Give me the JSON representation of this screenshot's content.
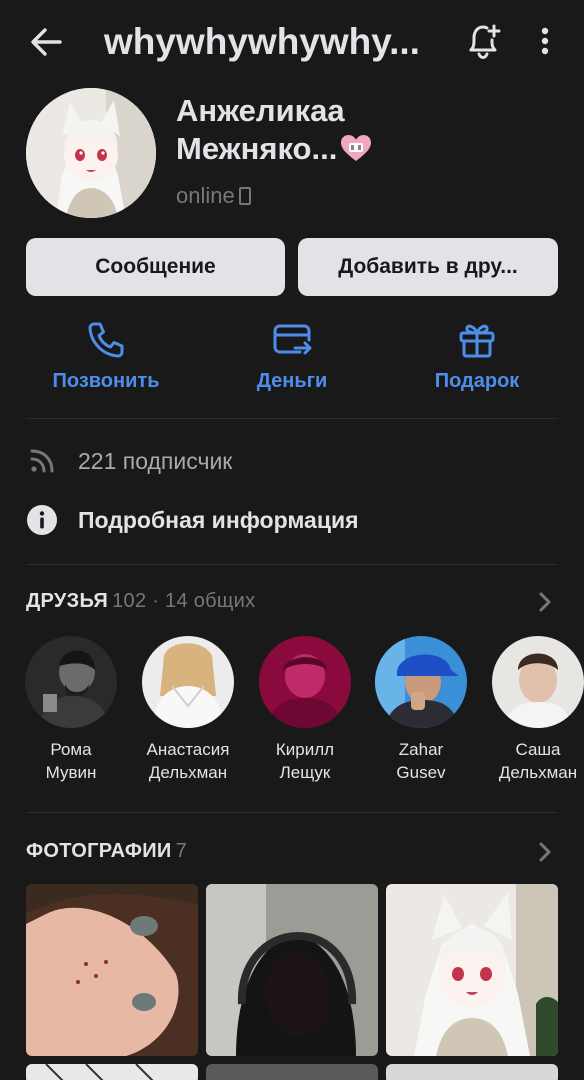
{
  "header": {
    "title": "whywhywhywhy...",
    "back_icon": "arrow-left-icon",
    "bell_icon": "bell-plus-icon",
    "more_icon": "more-vertical-icon"
  },
  "profile": {
    "name_line1": "Анжеликаа",
    "name_line2": "Межняко...",
    "status": "online"
  },
  "buttons": {
    "message": "Сообщение",
    "add_friend": "Добавить в дру..."
  },
  "actions": [
    {
      "label": "Позвонить",
      "icon": "phone-icon"
    },
    {
      "label": "Деньги",
      "icon": "money-transfer-icon"
    },
    {
      "label": "Подарок",
      "icon": "gift-icon"
    }
  ],
  "info": {
    "followers": "221 подписчик",
    "details": "Подробная информация"
  },
  "friends_section": {
    "title": "ДРУЗЬЯ",
    "count": "102 · 14 общих",
    "items": [
      {
        "line1": "Рома",
        "line2": "Мувин"
      },
      {
        "line1": "Анастасия",
        "line2": "Дельхман"
      },
      {
        "line1": "Кирилл",
        "line2": "Лещук"
      },
      {
        "line1": "Zahar",
        "line2": "Gusev"
      },
      {
        "line1": "Саша",
        "line2": "Дельхман"
      }
    ]
  },
  "photos_section": {
    "title": "ФОТОГРАФИИ",
    "count": "7"
  },
  "colors": {
    "background": "#19191a",
    "accent": "#4c8ee9",
    "text": "#e1e3e6",
    "secondary": "#76787a"
  }
}
